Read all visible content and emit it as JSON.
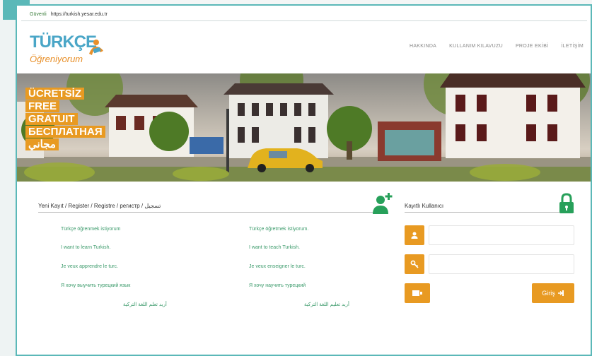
{
  "browser": {
    "secure_label": "Güvenli",
    "url": "https://turkish.yesar.edu.tr"
  },
  "logo": {
    "main": "TÜRKÇE",
    "sub": "Öğreniyorum"
  },
  "nav": {
    "items": [
      "HAKKINDA",
      "KULLANIM KILAVUZU",
      "PROJE EKİBİ",
      "İLETİŞİM"
    ]
  },
  "banner": {
    "free_lines": [
      "ÜCRETSİZ",
      "FREE",
      "GRATUIT",
      "БЕСПЛАТНАЯ",
      "مجاني"
    ]
  },
  "registration": {
    "title": "Yeni Kayıt / Register / Registre / регистр / تسجيل",
    "learner_options": [
      "Türkçe öğrenmek istiyorum",
      "I want to learn Turkish.",
      "Je veux apprendre le turc.",
      "Я хочу выучить турецкий язык",
      "أريد تعلم اللغة التركية"
    ],
    "teacher_options": [
      "Türkçe öğretmek istiyorum.",
      "I want to teach Turkish.",
      "Je veux enseigner le turc.",
      "Я хочу научить турецкий",
      "أريد تعليم اللغة التركية"
    ]
  },
  "login": {
    "title": "Kayıtlı Kullanıcı",
    "button_label": "Giriş"
  },
  "colors": {
    "accent": "#e89a22",
    "frame": "#5bb8b8",
    "icon_green": "#27a05a",
    "link_green": "#3a9a6a"
  }
}
